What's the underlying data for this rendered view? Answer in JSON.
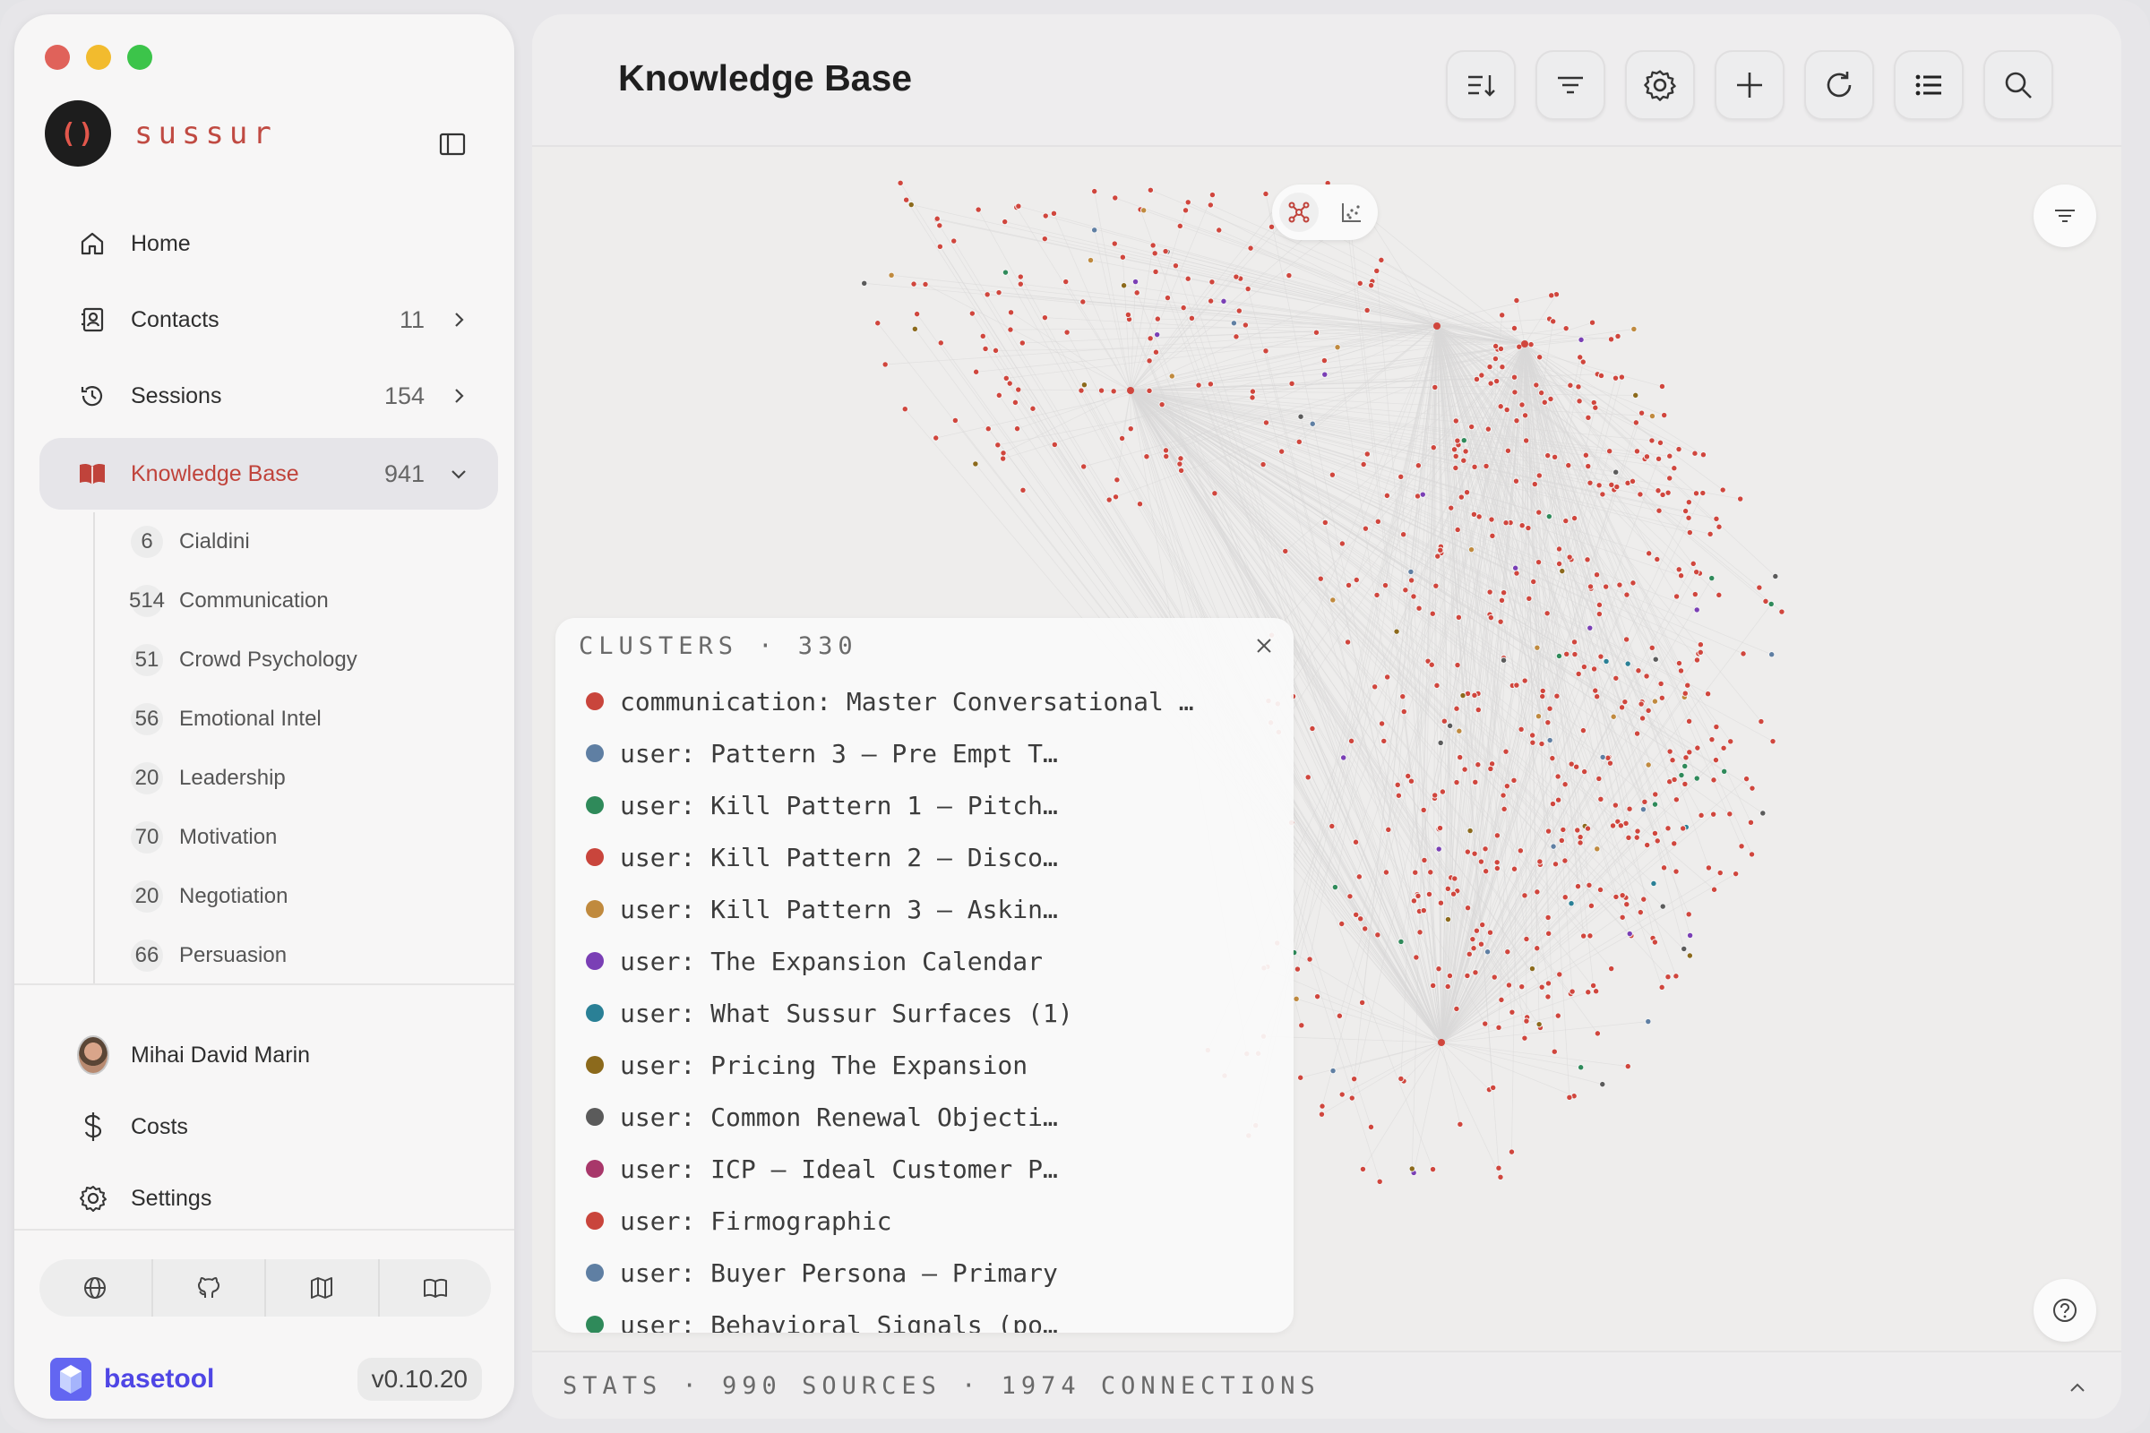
{
  "sidebar": {
    "brand": "sussur",
    "logo_mark": "()",
    "nav": [
      {
        "label": "Home",
        "icon": "home-icon"
      },
      {
        "label": "Contacts",
        "count": "11",
        "icon": "contacts-icon"
      },
      {
        "label": "Sessions",
        "count": "154",
        "icon": "history-icon"
      },
      {
        "label": "Knowledge Base",
        "count": "941",
        "icon": "book-icon",
        "active": true
      }
    ],
    "kb_categories": [
      {
        "count": "6",
        "label": "Cialdini"
      },
      {
        "count": "514",
        "label": "Communication"
      },
      {
        "count": "51",
        "label": "Crowd Psychology"
      },
      {
        "count": "56",
        "label": "Emotional Intel"
      },
      {
        "count": "20",
        "label": "Leadership"
      },
      {
        "count": "70",
        "label": "Motivation"
      },
      {
        "count": "20",
        "label": "Negotiation"
      },
      {
        "count": "66",
        "label": "Persuasion"
      }
    ],
    "user_name": "Mihai David Marin",
    "costs": "Costs",
    "settings": "Settings",
    "footer_brand": "basetool",
    "version": "v0.10.20"
  },
  "main": {
    "title": "Knowledge Base",
    "toolbar": [
      "sort-icon",
      "filter-icon",
      "gear-icon",
      "plus-icon",
      "refresh-icon",
      "list-icon",
      "search-icon"
    ]
  },
  "clusters": {
    "header": "CLUSTERS · 330",
    "items": [
      {
        "label": "communication: Master Conversational …",
        "color": "#c9453c"
      },
      {
        "label": "user: Pattern 3 — Pre Empt T…",
        "color": "#5f7fa3"
      },
      {
        "label": "user: Kill Pattern 1 — Pitch…",
        "color": "#2f8a5a"
      },
      {
        "label": "user: Kill Pattern 2 — Disco…",
        "color": "#c9453c"
      },
      {
        "label": "user: Kill Pattern 3 — Askin…",
        "color": "#c08a3e"
      },
      {
        "label": "user: The Expansion Calendar",
        "color": "#7a3fb5"
      },
      {
        "label": "user: What Sussur Surfaces (1)",
        "color": "#2a8096"
      },
      {
        "label": "user: Pricing The Expansion",
        "color": "#8c6a1c"
      },
      {
        "label": "user: Common Renewal Objecti…",
        "color": "#5b5b5b"
      },
      {
        "label": "user: ICP — Ideal Customer P…",
        "color": "#a8376a"
      },
      {
        "label": "user: Firmographic",
        "color": "#c9453c"
      },
      {
        "label": "user: Buyer Persona — Primary",
        "color": "#5f7fa3"
      },
      {
        "label": "user: Behavioral Signals (po…",
        "color": "#2f8a5a"
      }
    ]
  },
  "stats": {
    "text": "STATS · 990 SOURCES · 1974 CONNECTIONS"
  },
  "colors": {
    "accent": "#c0433b",
    "node_default": "#d0463d",
    "node_palette": [
      "#5f7fa3",
      "#2f8a5a",
      "#c08a3e",
      "#7a3fb5",
      "#2a8096",
      "#8c6a1c",
      "#5b5b5b"
    ],
    "basetool": "#4f46e5"
  }
}
